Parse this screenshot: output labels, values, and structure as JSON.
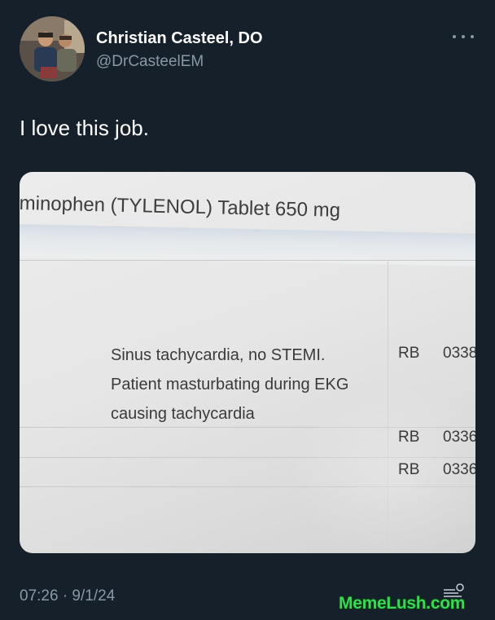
{
  "tweet": {
    "author": {
      "display_name": "Christian Casteel, DO",
      "handle": "@DrCasteelEM",
      "avatar_icon": "profile-photo"
    },
    "more_icon": "more-horizontal-icon",
    "text": "I love this job.",
    "timestamp": "07:26 · 9/1/24"
  },
  "media": {
    "header": "minophen (TYLENOL) Tablet 650 mg",
    "note_lines": [
      "Sinus tachycardia, no STEMI.",
      "Patient masturbating during EKG",
      "causing tachycardia"
    ],
    "rows": [
      {
        "initials": "RB",
        "code": "0338"
      },
      {
        "initials": "RB",
        "code": "0336"
      },
      {
        "initials": "RB",
        "code": "0336"
      }
    ]
  },
  "watermark": {
    "text": "MemeLush.com",
    "color": "#3ed65a"
  },
  "colors": {
    "background": "#15202b",
    "primary_text": "#ffffff",
    "secondary_text": "#8899a6"
  }
}
